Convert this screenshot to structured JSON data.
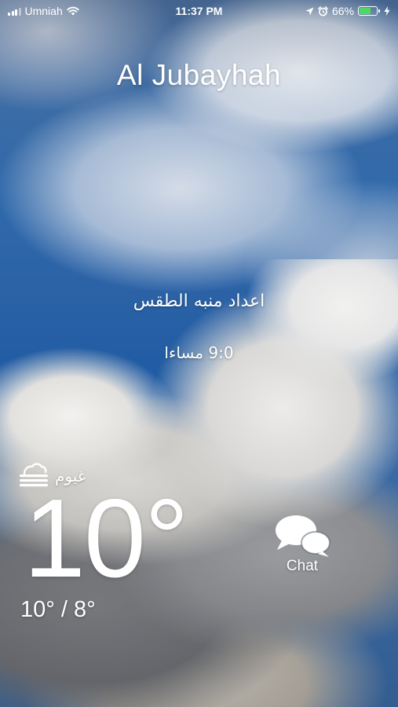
{
  "status_bar": {
    "carrier": "Umniah",
    "time": "11:37 PM",
    "battery_percent": "66%",
    "battery_level": 0.66,
    "battery_color": "#4cd964",
    "icons": [
      "signal-icon",
      "wifi-icon",
      "location-icon",
      "alarm-icon",
      "battery-icon",
      "charging-icon"
    ]
  },
  "location": {
    "city": "Al Jubayhah"
  },
  "alert": {
    "title": "اعداد منبه الطقس",
    "time": "9:0 مساءا"
  },
  "current": {
    "condition_icon": "cloudy-fog-icon",
    "condition": "غيوم",
    "temperature": "10°",
    "high_low": "10° / 8°"
  },
  "chat": {
    "icon": "chat-bubbles-icon",
    "label": "Chat"
  }
}
